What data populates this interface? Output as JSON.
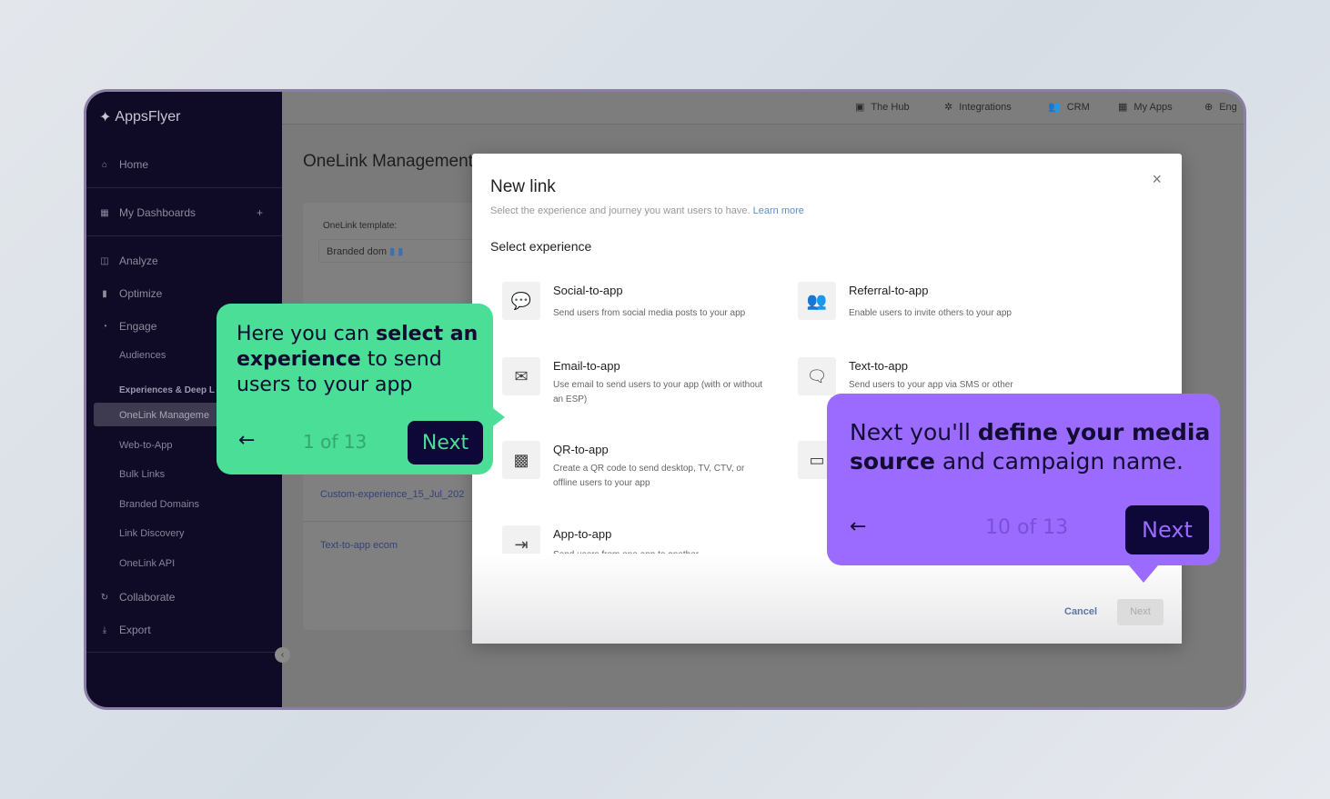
{
  "sidebar": {
    "brand": "AppsFlyer",
    "items": [
      {
        "label": "Home",
        "icon": "home-icon"
      },
      {
        "label": "My Dashboards",
        "icon": "dashboard-icon",
        "action": "+"
      },
      {
        "label": "Analyze",
        "icon": "analyze-icon"
      },
      {
        "label": "Optimize",
        "icon": "bar-chart-icon"
      },
      {
        "label": "Engage",
        "icon": "engage-icon"
      },
      {
        "label": "Collaborate",
        "icon": "sync-icon"
      },
      {
        "label": "Export",
        "icon": "download-icon"
      }
    ],
    "sub": [
      "Audiences",
      "Experiences & Deep L",
      "OneLink Manageme",
      "Web-to-App",
      "Bulk Links",
      "Branded Domains",
      "Link Discovery",
      "OneLink API"
    ]
  },
  "topnav": [
    "The Hub",
    "Integrations",
    "CRM",
    "My Apps",
    "Eng"
  ],
  "main": {
    "title": "OneLink Management",
    "template_label": "OneLink template:",
    "template_value": "Branded dom",
    "rows": [
      "Custom-experience_15_Jul_202",
      "Text-to-app ecom"
    ]
  },
  "modal": {
    "title": "New link",
    "subtitle": "Select the experience and journey you want users to have.",
    "learn_more": "Learn more",
    "section": "Select experience",
    "options": [
      {
        "title": "Social-to-app",
        "desc": "Send users from social media posts to your app",
        "icon": "social-icon"
      },
      {
        "title": "Referral-to-app",
        "desc": "Enable users to invite others to your app",
        "icon": "referral-icon"
      },
      {
        "title": "Email-to-app",
        "desc": "Use email to send users to your app (with or without an ESP)",
        "icon": "email-icon"
      },
      {
        "title": "Text-to-app",
        "desc": "Send users to your app via SMS or other",
        "icon": "chat-icon"
      },
      {
        "title": "QR-to-app",
        "desc": "Create a QR code to send desktop, TV, CTV, or offline users to your app",
        "icon": "qr-icon"
      },
      {
        "title": "",
        "desc": "",
        "icon": "web-icon"
      },
      {
        "title": "App-to-app",
        "desc": "Send users from one app to another",
        "icon": "app-to-app-icon"
      }
    ],
    "cancel": "Cancel",
    "next": "Next"
  },
  "tip1": {
    "pre": "Here you can ",
    "bold": "select an experience",
    "post": " to send users to your app",
    "counter": "1 of 13",
    "next": "Next",
    "color": "#4ade96"
  },
  "tip2": {
    "pre": "Next you'll ",
    "bold": "define your media source",
    "post": " and campaign name.",
    "counter": "10 of 13",
    "next": "Next",
    "color": "#9b6bff"
  }
}
